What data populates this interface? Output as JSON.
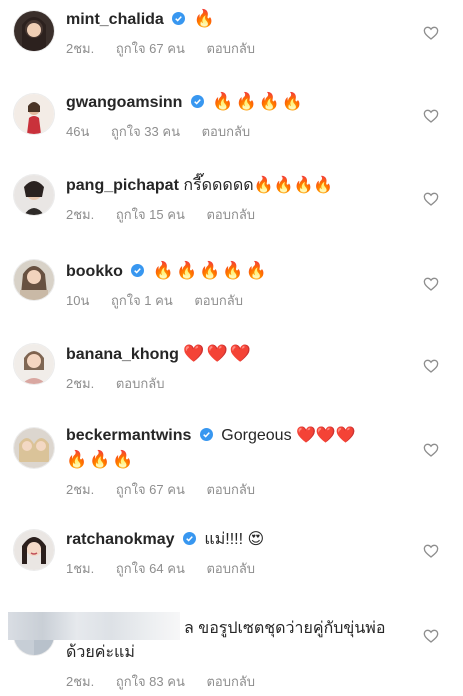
{
  "comments": [
    {
      "username": "mint_chalida",
      "verified": true,
      "text": "🔥",
      "time": "2ชม.",
      "likes": "ถูกใจ 67 คน",
      "reply": "ตอบกลับ"
    },
    {
      "username": "gwangoamsinn",
      "verified": true,
      "text": "🔥🔥🔥🔥",
      "time": "46น",
      "likes": "ถูกใจ 33 คน",
      "reply": "ตอบกลับ"
    },
    {
      "username": "pang_pichapat",
      "verified": false,
      "text": "กรี๊ดดดดด🔥🔥🔥🔥",
      "time": "2ชม.",
      "likes": "ถูกใจ 15 คน",
      "reply": "ตอบกลับ"
    },
    {
      "username": "bookko",
      "verified": true,
      "text": "🔥🔥🔥🔥🔥",
      "time": "10น",
      "likes": "ถูกใจ 1 คน",
      "reply": "ตอบกลับ"
    },
    {
      "username": "banana_khong",
      "verified": false,
      "text": "❤️❤️❤️",
      "time": "2ชม.",
      "likes": "",
      "reply": "ตอบกลับ"
    },
    {
      "username": "beckermantwins",
      "verified": true,
      "text": "Gorgeous ❤️❤️❤️",
      "text2": "🔥🔥🔥",
      "time": "2ชม.",
      "likes": "ถูกใจ 67 คน",
      "reply": "ตอบกลับ"
    },
    {
      "username": "ratchanokmay",
      "verified": true,
      "text": "แม่!!!! 😍",
      "time": "1ชม.",
      "likes": "ถูกใจ 64 คน",
      "reply": "ตอบกลับ"
    },
    {
      "username": "",
      "verified": false,
      "text": "ล ขอรูปเซตชุดว่ายคู่กับขุ่นพ่อ",
      "text2": "ด้วยค่ะแม่",
      "time": "2ชม.",
      "likes": "ถูกใจ 83 คน",
      "reply": "ตอบกลับ"
    }
  ],
  "colors": {
    "text": "#262626",
    "meta": "#8e8e8e",
    "verified": "#3897f0",
    "heart_outline": "#8e8e8e"
  },
  "icons": {
    "verified": "verified-badge-icon",
    "like": "heart-outline-icon"
  }
}
